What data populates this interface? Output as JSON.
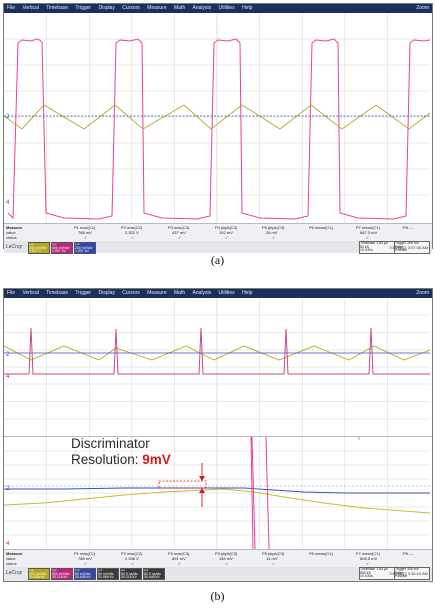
{
  "menu": [
    "File",
    "Vertical",
    "Timebase",
    "Trigger",
    "Display",
    "Cursors",
    "Measure",
    "Math",
    "Analysis",
    "Utilities",
    "Help"
  ],
  "zoom_label": "Zoom",
  "brand": "LeCroy",
  "measure_header": {
    "row1": "Measure",
    "row2": "value",
    "row3": "status"
  },
  "panel_a": {
    "caption": "(a)",
    "timestamp": "7/30/2012 3:57:06 AM",
    "params": [
      {
        "name": "P1 max(C1)",
        "value": "788 mV",
        "status": "✓"
      },
      {
        "name": "P2 max(C2)",
        "value": "2.322 V",
        "status": "✓"
      },
      {
        "name": "P3 max(C3)",
        "value": "437 mV",
        "status": "✓"
      },
      {
        "name": "P4 pkpk(C3)",
        "value": "192 mV",
        "status": "✓"
      },
      {
        "name": "P5 pkpk(C3)",
        "value": "26 mV",
        "status": "✓"
      },
      {
        "name": "P6 mean(C1)",
        "value": "",
        "status": ""
      },
      {
        "name": "P7 mean(C1)",
        "value": "687.3 mV",
        "status": "✓"
      },
      {
        "name": "P8 ---",
        "value": "",
        "status": ""
      }
    ],
    "channels": [
      {
        "label": "C1",
        "lines": [
          "200 mV/div",
          "-469.5 mV",
          "1.547 V"
        ],
        "color": "#b5a81e"
      },
      {
        "label": "C2",
        "lines": [
          "500 mV/div",
          "-1.6250 V",
          "1.907 kV"
        ],
        "color": "#b9267a"
      },
      {
        "label": "C3",
        "lines": [
          "200 mV/div",
          "-469.5 mV",
          "1.907 kV"
        ],
        "color": "#3245a8"
      }
    ],
    "timebase": {
      "label": "Timebase",
      "value": "1.60 µs",
      "lines": [
        "50 kS",
        "10 GS/s"
      ]
    },
    "trigger": {
      "label": "Trigger",
      "value": "308 mV",
      "lines": [
        "Edge",
        "Positive"
      ]
    }
  },
  "panel_b": {
    "caption": "(b)",
    "timestamp": "7/30/2012 3:36:10 AM",
    "annotation": {
      "line1": "Discriminator",
      "line2_prefix": "Resolution: ",
      "line2_value": "9mV"
    },
    "params": [
      {
        "name": "P1 max(C1)",
        "value": "788 mV",
        "status": "✓"
      },
      {
        "name": "P2 max(C2)",
        "value": "2.936 V",
        "status": "✓"
      },
      {
        "name": "P3 max(C3)",
        "value": "891 mV",
        "status": "✓"
      },
      {
        "name": "P4 pkpk(C3)",
        "value": "184 mV",
        "status": "✓"
      },
      {
        "name": "P5 pkpk(C3)",
        "value": "14 mV",
        "status": "✓"
      },
      {
        "name": "P6 mean(C1)",
        "value": "",
        "status": ""
      },
      {
        "name": "P7 mean(C1)",
        "value": "808.5 mV",
        "status": "✓"
      },
      {
        "name": "P8 ---",
        "value": "",
        "status": ""
      }
    ],
    "channels": [
      {
        "label": "C1",
        "lines": [
          "200 mV/div",
          "-469.5 mV",
          "31.006 kV"
        ],
        "color": "#b5a81e"
      },
      {
        "label": "C2",
        "lines": [
          "500 mV/div",
          "-1.6250 V",
          "30.218 kV"
        ],
        "color": "#b9267a"
      },
      {
        "label": "C3",
        "lines": [
          "50 mV/div",
          "-469.5 mV",
          "30.648 kV"
        ],
        "color": "#3245a8"
      },
      {
        "label": "Z1",
        "lines": [
          "50 mV/div",
          "",
          "31.066 kV"
        ],
        "color": "#3a3a3a"
      },
      {
        "label": "Z2",
        "lines": [
          "50.0 ns/div",
          "",
          "30.218 kV"
        ],
        "color": "#3a3a3a"
      },
      {
        "label": "Z3",
        "lines": [
          "50.0 ns/div",
          "",
          "30.648 kV"
        ],
        "color": "#3a3a3a"
      }
    ],
    "timebase": {
      "label": "Timebase",
      "value": "1.60 µs",
      "lines": [
        "500 kS",
        "10 GS/s"
      ]
    },
    "trigger": {
      "label": "Trigger",
      "value": "308 mV",
      "lines": [
        "Edge",
        "Positive"
      ]
    }
  },
  "colors": {
    "c1_yellow": "#b5a81e",
    "c2_magenta": "#e4439b",
    "c3_blue": "#3b4ec7",
    "annotation_red": "#d11a1a",
    "menubar": "#1d2f5e"
  }
}
